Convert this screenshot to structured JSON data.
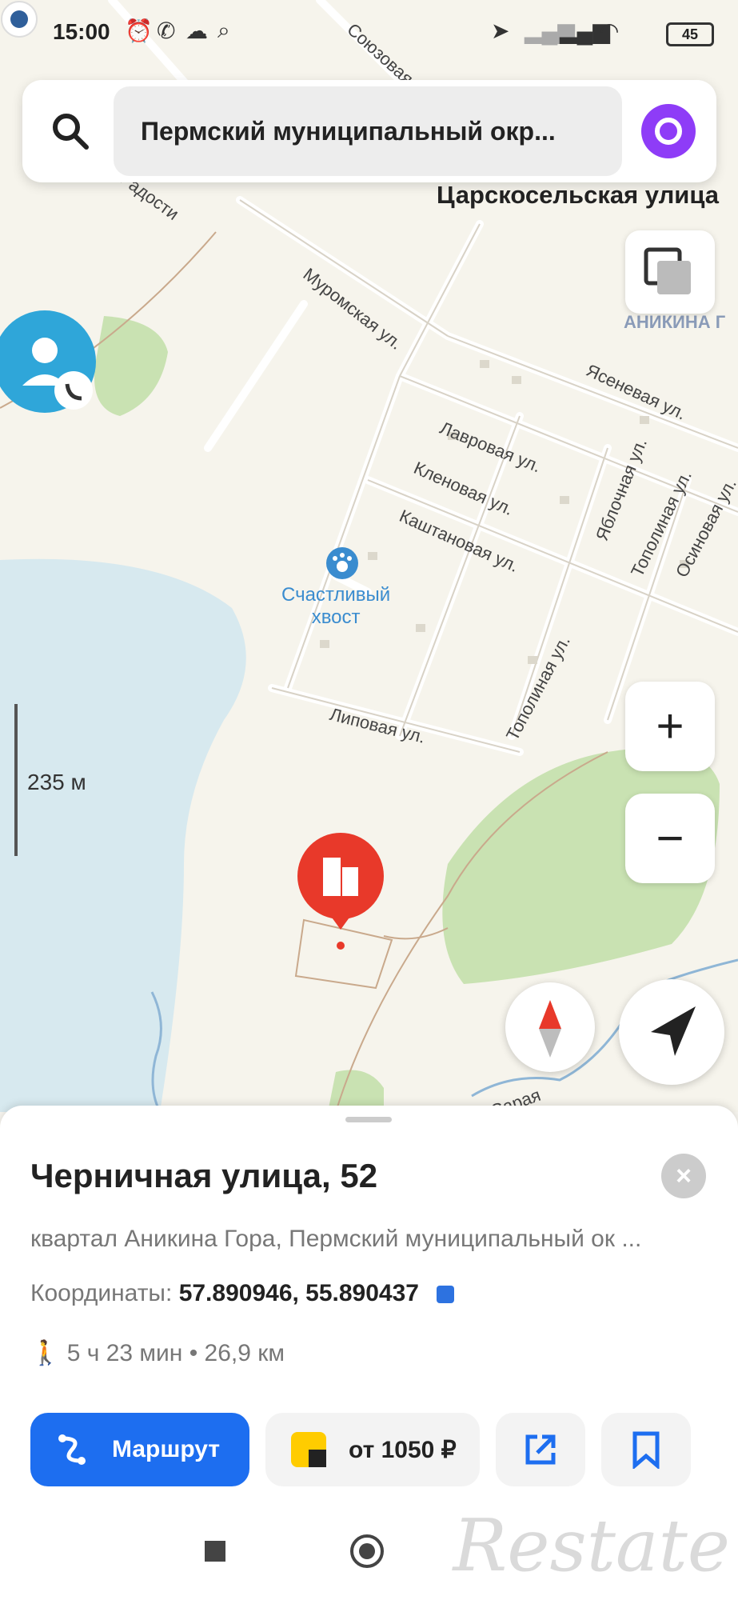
{
  "status_bar": {
    "time": "15:00",
    "battery": "45"
  },
  "search": {
    "query": "Пермский муниципальный окр..."
  },
  "map": {
    "selected_street": "Царскосельская улица",
    "district_label": "АНИКИНА Г",
    "scale": "235 м",
    "poi_line1": "Счастливый",
    "poi_line2": "хвост",
    "streets": {
      "muromskaya": "Муромская ул.",
      "yasenevaya": "Ясеневая ул.",
      "lavrovaya": "Лавровая ул.",
      "klenovaya": "Кленовая ул.",
      "kashtanovaya": "Каштановая ул.",
      "yablochnaya": "Яблочная ул.",
      "topolinaya": "Тополиная ул.",
      "osinovaya": "Осиновая ул.",
      "lipovaya": "Липовая ул.",
      "topolinaya2": "Тополиная ул.",
      "radosti": "Радости",
      "soyuzovaya": "Союзовая ул.",
      "saraya": "Сарая"
    }
  },
  "place": {
    "title": "Черничная улица, 52",
    "subtitle": "квартал Аникина Гора, Пермский муниципальный ок ...",
    "coords_label": "Координаты:",
    "coords_value": "57.890946, 55.890437",
    "walk_time": "5 ч 23 мин",
    "walk_distance": "26,9 км"
  },
  "actions": {
    "route": "Маршрут",
    "taxi": "от 1050 ₽"
  },
  "watermark": "Restate",
  "colors": {
    "accent": "#1d6ef0",
    "pin": "#e8392a",
    "water": "#d7e9ef",
    "park": "#c9e2b2",
    "alice": "#8e3cf7"
  }
}
